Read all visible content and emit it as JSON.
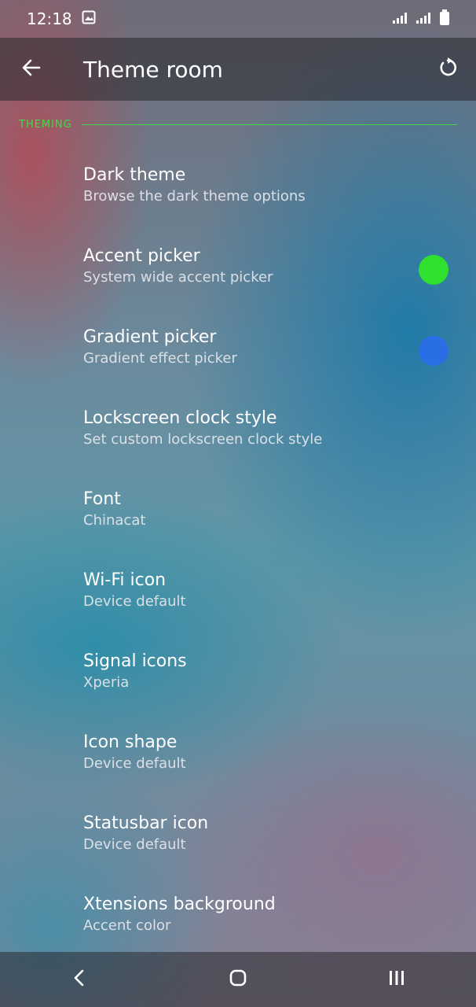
{
  "status_bar": {
    "time": "12:18",
    "icons": [
      "gallery-notification-icon",
      "signal-icon",
      "signal-icon",
      "battery-icon"
    ]
  },
  "app_bar": {
    "title": "Theme room",
    "back_icon": "arrow-left-icon",
    "action_icon": "reset-icon"
  },
  "section": {
    "label": "THEMING",
    "color": "#43d94a"
  },
  "items": [
    {
      "title": "Dark theme",
      "summary": "Browse the dark theme options"
    },
    {
      "title": "Accent picker",
      "summary": "System wide accent picker",
      "swatch_color": "#2fe02f"
    },
    {
      "title": "Gradient picker",
      "summary": "Gradient effect picker",
      "swatch_color": "#2a6ee6"
    },
    {
      "title": "Lockscreen clock style",
      "summary": "Set custom lockscreen clock style"
    },
    {
      "title": "Font",
      "summary": "Chinacat"
    },
    {
      "title": "Wi-Fi icon",
      "summary": "Device default"
    },
    {
      "title": "Signal icons",
      "summary": "Xperia"
    },
    {
      "title": "Icon shape",
      "summary": "Device default"
    },
    {
      "title": "Statusbar icon",
      "summary": "Device default"
    },
    {
      "title": "Xtensions background",
      "summary": "Accent color"
    }
  ],
  "nav_bar": {
    "icons": [
      "back-nav-icon",
      "home-nav-icon",
      "recents-nav-icon"
    ]
  }
}
